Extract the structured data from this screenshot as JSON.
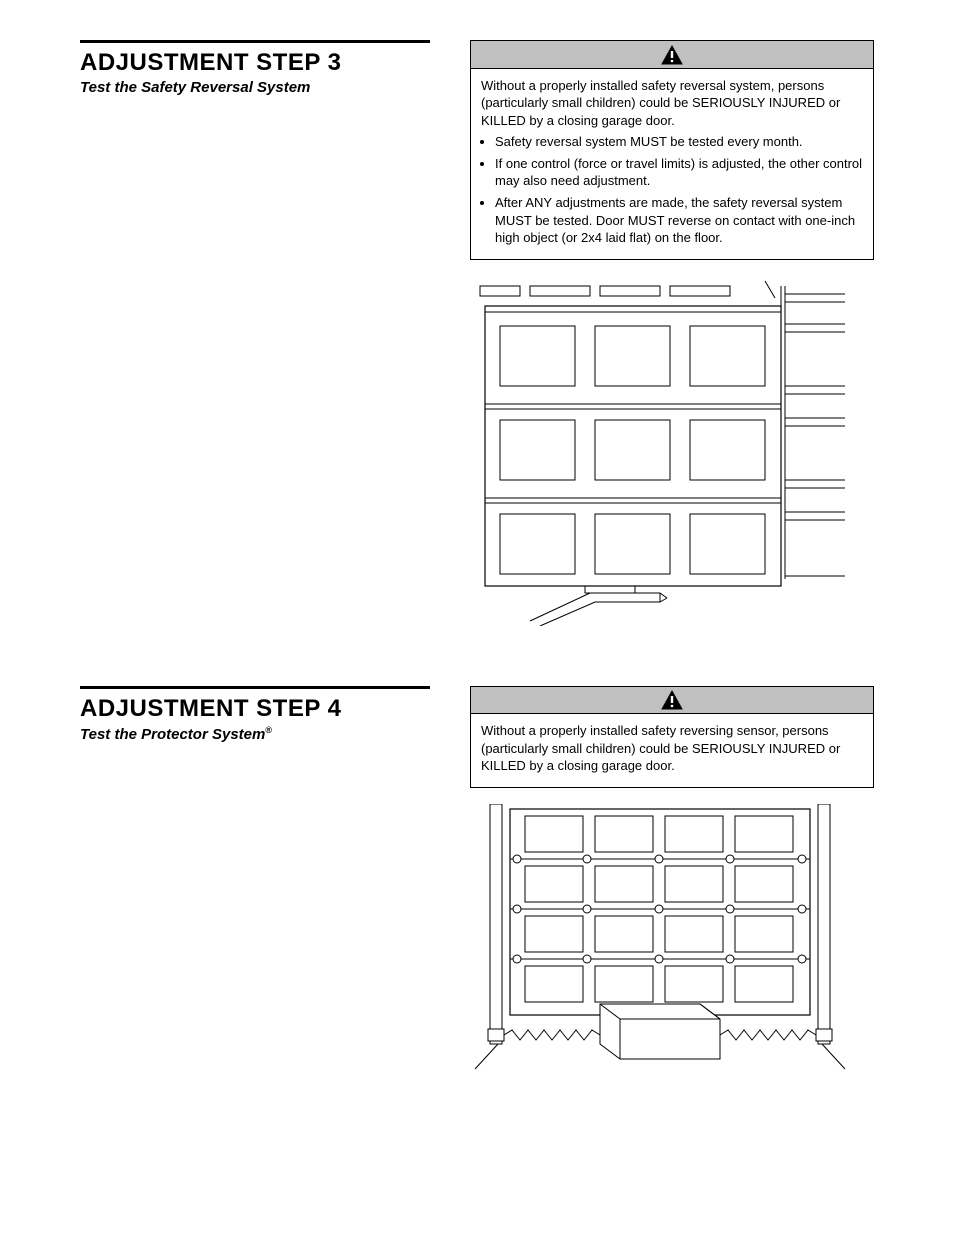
{
  "step3": {
    "title": "ADJUSTMENT STEP 3",
    "subtitle": "Test the Safety Reversal System",
    "warning_intro": "Without a properly installed safety reversal system, persons (particularly small children) could be SERIOUSLY INJURED or KILLED by a closing garage door.",
    "bullets": [
      "Safety reversal system MUST be tested every month.",
      "If one control (force or travel limits) is adjusted, the other control may also need adjustment.",
      "After ANY adjustments are made, the safety reversal system MUST be tested. Door MUST reverse on contact with one-inch high object (or 2x4 laid flat) on the floor."
    ]
  },
  "step4": {
    "title": "ADJUSTMENT STEP 4",
    "subtitle_pre": "Test the Protector System",
    "subtitle_sup": "®",
    "warning_intro": "Without a properly installed safety reversing sensor, persons (particularly small children) could be SERIOUSLY INJURED or KILLED by a closing garage door."
  },
  "icons": {
    "warning": "⚠"
  }
}
